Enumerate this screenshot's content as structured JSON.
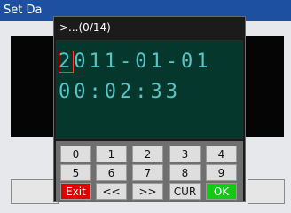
{
  "background_dialog": {
    "title": "Set Da"
  },
  "keypad": {
    "header": ">...(0/14)",
    "display": {
      "cursor_char": "2",
      "line1_rest": "011-01-01",
      "line2": "00:02:33"
    },
    "keys_row1": [
      "0",
      "1",
      "2",
      "3",
      "4"
    ],
    "keys_row2": [
      "5",
      "6",
      "7",
      "8",
      "9"
    ],
    "action_keys": {
      "exit": "Exit",
      "prev": "<<",
      "next": ">>",
      "cur": "CUR",
      "ok": "OK"
    }
  },
  "colors": {
    "exit": "#e00000",
    "ok": "#13c913",
    "display_text": "#53c6c6",
    "display_bg": "#06372d"
  }
}
